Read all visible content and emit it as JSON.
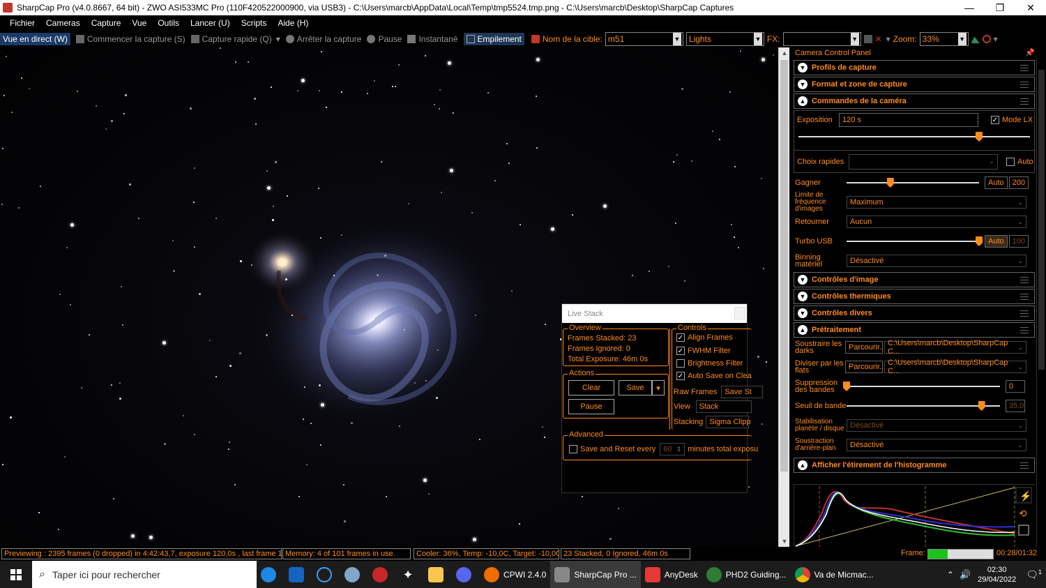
{
  "window": {
    "title": "SharpCap Pro (v4.0.8667, 64 bit) - ZWO ASI533MC Pro (110F420522000900, via USB3) - C:\\Users\\marcb\\AppData\\Local\\Temp\\tmp5524.tmp.png - C:\\Users\\marcb\\Desktop\\SharpCap Captures",
    "min": "—",
    "max": "❐",
    "close": "✕"
  },
  "menu": [
    "Fichier",
    "Cameras",
    "Capture",
    "Vue",
    "Outils",
    "Lancer (U)",
    "Scripts",
    "Aide (H)"
  ],
  "toolbar": {
    "live_view": "Vue en direct (W)",
    "start_capture": "Commencer la capture (S)",
    "quick_capture": "Capture rapide (Q)",
    "stop_capture": "Arrêter la capture",
    "pause": "Pause",
    "snapshot": "Instantané",
    "stacking": "Empilement",
    "target_label": "Nom de la cible:",
    "target_value": "m51",
    "frame_type": "Lights",
    "fx_label": "FX:",
    "fx_value": "",
    "zoom_label": "Zoom:",
    "zoom_value": "33%"
  },
  "panel": {
    "title": "Camera Control Panel",
    "sections": {
      "profiles": "Profils de capture",
      "format": "Format et zone de capture",
      "camera_controls": "Commandes de la caméra",
      "image_controls": "Contrôles d'image",
      "thermal": "Contrôles thermiques",
      "misc": "Contrôles divers",
      "preprocessing": "Prétraitement",
      "histogram": "Afficher l'étirement de l'histogramme"
    },
    "exposure_label": "Exposition",
    "exposure_value": "120 s",
    "lx_mode": "Mode LX",
    "quick_picks_label": "Choix rapides",
    "quick_picks_value": "",
    "auto_label": "Auto",
    "gain_label": "Gagner",
    "gain_auto": "Auto",
    "gain_value": "200",
    "framerate_label": "Limite de fréquence d'images",
    "framerate_value": "Maximum",
    "flip_label": "Retourner",
    "flip_value": "Aucun",
    "turbo_label": "Turbo USB",
    "turbo_auto": "Auto",
    "turbo_value": "100",
    "binning_label": "Binning matériel",
    "binning_value": "Désactivé",
    "darks_label": "Soustraire les darks",
    "darks_browse": "Parcourir...",
    "darks_path": "C:\\Users\\marcb\\Desktop\\SharpCap C...",
    "flats_label": "Diviser par les flats",
    "flats_browse": "Parcourir...",
    "flats_path": "C:\\Users\\marcb\\Desktop\\SharpCap C...",
    "banding_label": "Suppression des bandes",
    "banding_value": "0",
    "band_threshold_label": "Seuil de bande",
    "band_threshold_value": "35,0",
    "stabilization_label": "Stabilisation planète / disque",
    "stabilization_value": "Désactivé",
    "bg_sub_label": "Soustraction d'arrière-plan",
    "bg_sub_value": "Désactivé",
    "levels": {
      "exposure": 0.78,
      "gain": 0.33,
      "turbo": 1.0,
      "banding": 0.0,
      "band_threshold": 0.88
    }
  },
  "livestack": {
    "title": "Live Stack",
    "overview_label": "Overview",
    "frames_stacked": "Frames Stacked: 23",
    "frames_ignored": "Frames Ignored:  0",
    "total_exposure": "Total Exposure:   46m 0s",
    "actions_label": "Actions",
    "clear": "Clear",
    "save": "Save",
    "pause": "Pause",
    "controls_label": "Controls",
    "align": "Align Frames",
    "fwhm": "FWHM Filter",
    "brightness": "Brightness Filter",
    "autosave": "Auto Save on Clea",
    "raw_frames_label": "Raw Frames",
    "raw_frames_value": "Save St",
    "view_label": "View",
    "view_value": "Stack",
    "stacking_label": "Stacking",
    "stacking_value": "Sigma Clipp",
    "advanced_label": "Advanced",
    "save_reset": "Save and Reset every",
    "minutes_value": "60",
    "minutes_label": "minutes total exposu"
  },
  "status": {
    "preview": "Previewing : 2395 frames (0 dropped) in 4:42:43,7, exposure 120,0s , last frame 120",
    "memory": "Memory: 4 of 101 frames in use.",
    "cooler": "Cooler: 36%, Temp: -10,0C, Target: -10,0C",
    "stacked": "23 Stacked, 0 Ignored, 46m 0s",
    "frame_label": "Frame:",
    "frame_time": "00:28/01:32",
    "frame_progress": 0.3
  },
  "taskbar": {
    "search": "Taper ici pour rechercher",
    "apps": [
      "CPWI 2.4.0",
      "SharpCap Pro ...",
      "AnyDesk",
      "PHD2 Guiding...",
      "Va de Micmac..."
    ],
    "time": "02:30",
    "date": "29/04/2022",
    "notif_count": "1"
  },
  "colors": {
    "accent": "#ff8c1a",
    "panel_bg": "#000000",
    "taskbar": "#1c1c1c"
  }
}
